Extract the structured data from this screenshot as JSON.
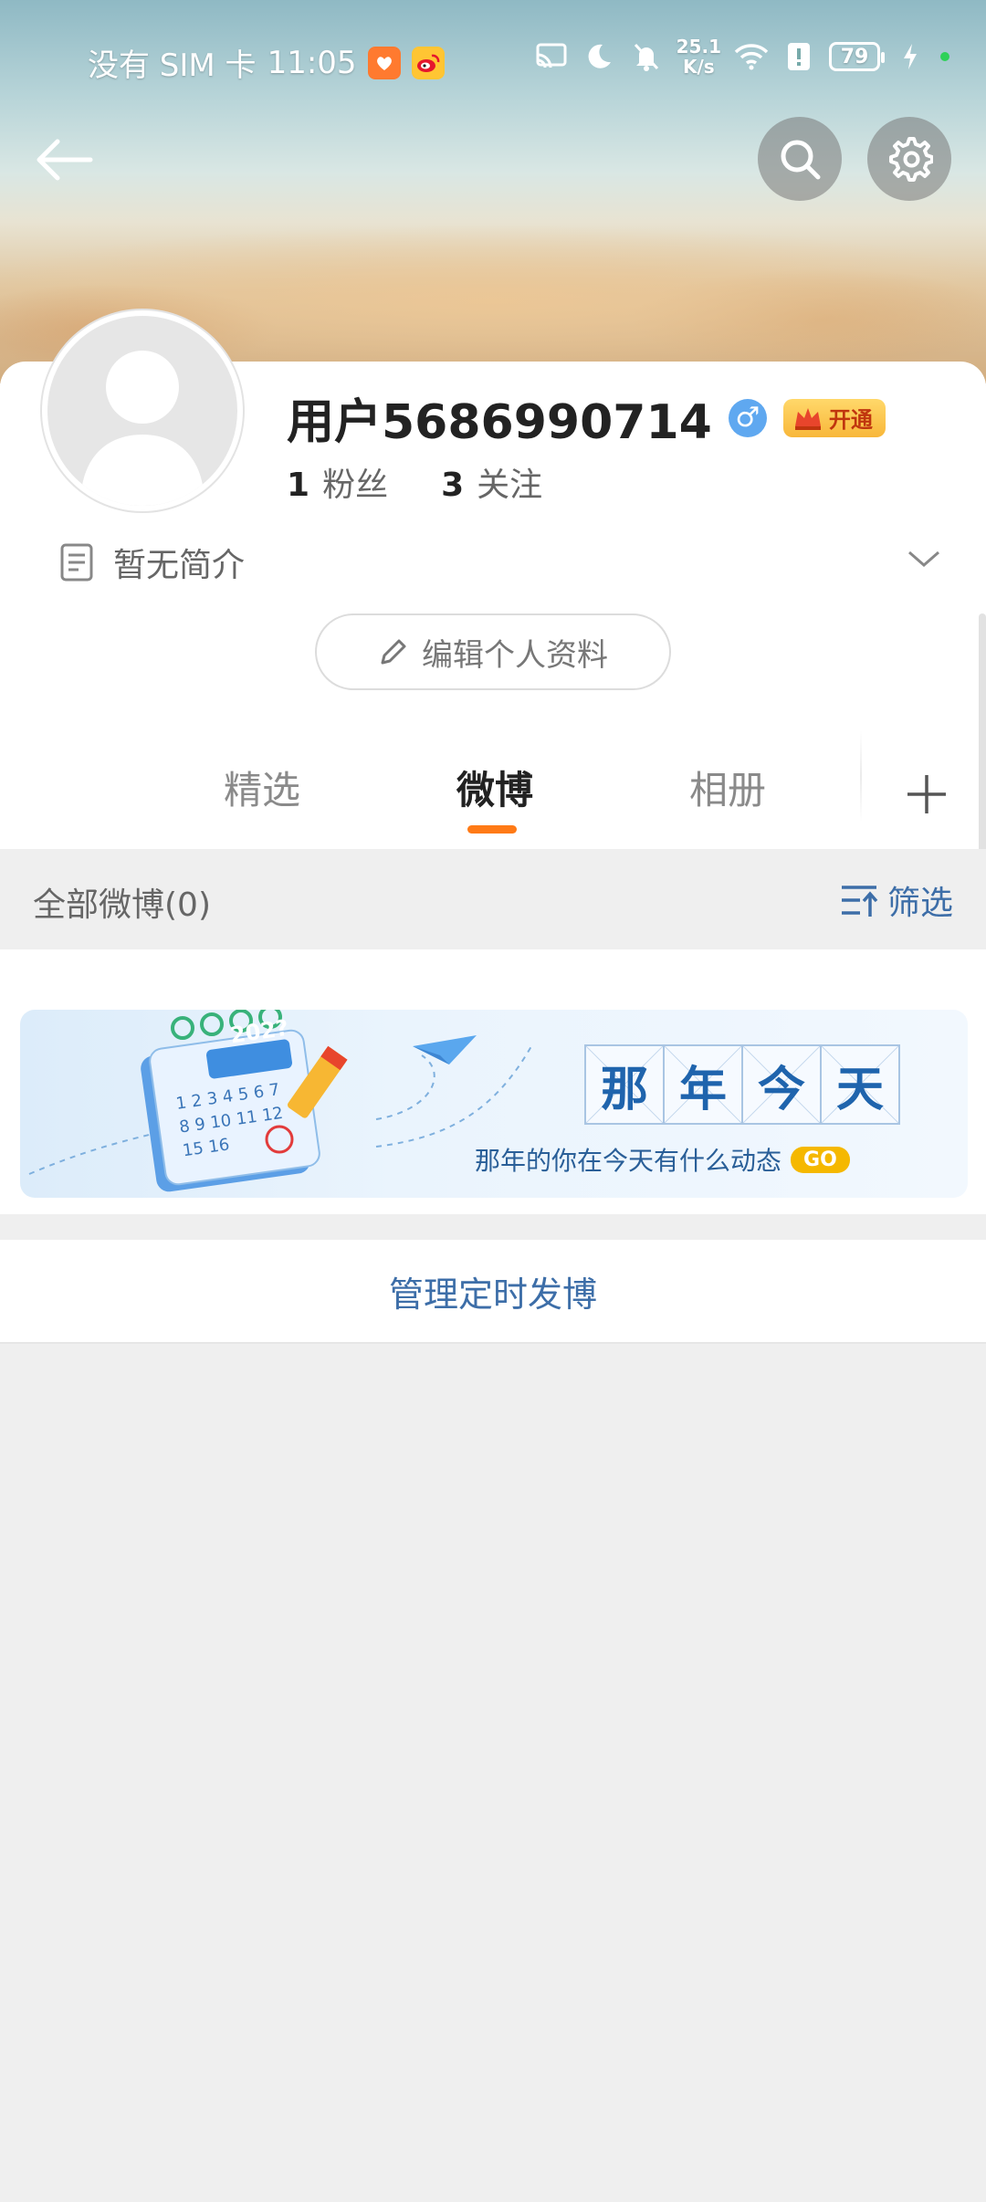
{
  "status_bar": {
    "carrier": "没有 SIM 卡",
    "time": "11:05",
    "net_speed_value": "25.1",
    "net_speed_unit": "K/s",
    "battery": "79"
  },
  "profile": {
    "username": "用户5686990714",
    "vip_label": "开通",
    "followers_count": "1",
    "followers_label": "粉丝",
    "following_count": "3",
    "following_label": "关注",
    "bio": "暂无简介",
    "edit_button": "编辑个人资料"
  },
  "tabs": [
    {
      "label": "精选"
    },
    {
      "label": "微博"
    },
    {
      "label": "相册"
    }
  ],
  "feed": {
    "count_label": "全部微博(0)",
    "filter_label": "筛选"
  },
  "banner": {
    "title_chars": [
      "那",
      "年",
      "今",
      "天"
    ],
    "subtitle": "那年的你在今天有什么动态",
    "go_label": "GO",
    "calendar_year": "202?"
  },
  "manage_scheduled": "管理定时发博",
  "colors": {
    "accent_orange": "#ff7a16",
    "link_blue": "#3d6ea8",
    "banner_blue": "#1f64ad"
  }
}
